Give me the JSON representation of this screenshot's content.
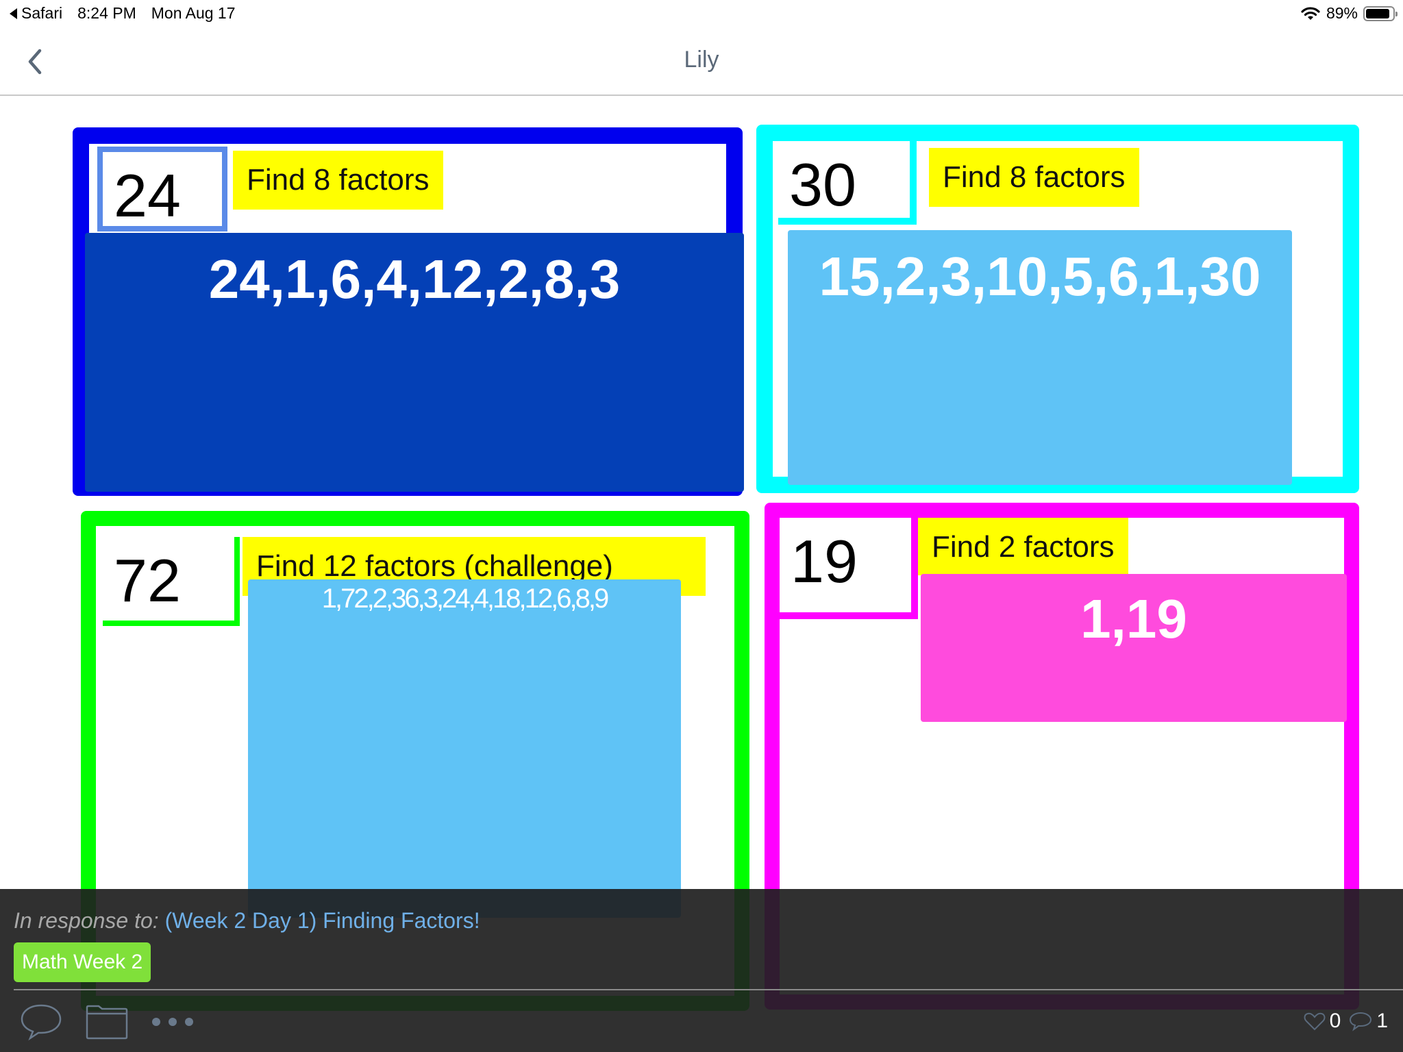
{
  "status_bar": {
    "back_app": "Safari",
    "time": "8:24 PM",
    "date": "Mon Aug 17",
    "battery": "89%",
    "battery_level": 0.89,
    "icons": [
      "back-triangle-icon",
      "wifi-icon",
      "battery-icon"
    ]
  },
  "nav": {
    "title": "Lily",
    "back_icon": "chevron-left-icon"
  },
  "panels": [
    {
      "number": "24",
      "task": "Find 8 factors",
      "answer": "24,1,6,4,12,2,8,3",
      "border_color": "#0000ee",
      "answer_bg": "#0440b6"
    },
    {
      "number": "30",
      "task": "Find 8 factors",
      "answer": "15,2,3,10,5,6,1,30",
      "border_color": "#00ffff",
      "answer_bg": "#5fc3f6"
    },
    {
      "number": "72",
      "task": "Find 12 factors (challenge)",
      "answer": "1,72,2,36,3,24,4,18,12,6,8,9",
      "border_color": "#00ff00",
      "answer_bg": "#5fc3f6"
    },
    {
      "number": "19",
      "task": "Find 2 factors",
      "answer": "1,19",
      "border_color": "#ff00ff",
      "answer_bg": "#ff4bdd"
    }
  ],
  "footer": {
    "response_label": "In response to:",
    "response_link": "(Week 2 Day 1) Finding Factors!",
    "tag": "Math Week 2",
    "tag_color": "#80e03a",
    "link_color": "#6fb0e8",
    "toolbar_icons": [
      "comment-icon",
      "folder-icon",
      "more-icon"
    ],
    "likes": "0",
    "comments": "1"
  }
}
